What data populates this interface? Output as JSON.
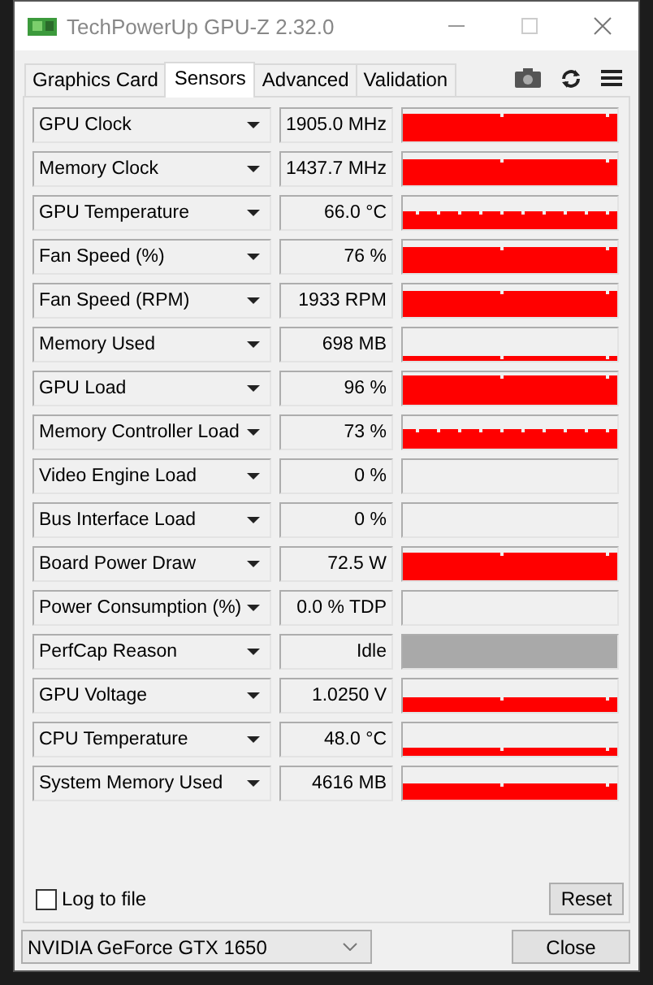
{
  "window": {
    "title": "TechPowerUp GPU-Z 2.32.0"
  },
  "tabs": [
    {
      "label": "Graphics Card",
      "selected": false
    },
    {
      "label": "Sensors",
      "selected": true
    },
    {
      "label": "Advanced",
      "selected": false
    },
    {
      "label": "Validation",
      "selected": false
    }
  ],
  "sensors": [
    {
      "name": "GPU Clock",
      "reading": "1905.0 MHz",
      "kind": "graph"
    },
    {
      "name": "Memory Clock",
      "reading": "1437.7 MHz",
      "kind": "graph"
    },
    {
      "name": "GPU Temperature",
      "reading": "66.0 °C",
      "kind": "graph"
    },
    {
      "name": "Fan Speed (%)",
      "reading": "76 %",
      "kind": "graph"
    },
    {
      "name": "Fan Speed (RPM)",
      "reading": "1933 RPM",
      "kind": "graph"
    },
    {
      "name": "Memory Used",
      "reading": "698 MB",
      "kind": "graph"
    },
    {
      "name": "GPU Load",
      "reading": "96 %",
      "kind": "graph"
    },
    {
      "name": "Memory Controller Load",
      "reading": "73 %",
      "kind": "graph"
    },
    {
      "name": "Video Engine Load",
      "reading": "0 %",
      "kind": "graph"
    },
    {
      "name": "Bus Interface Load",
      "reading": "0 %",
      "kind": "graph"
    },
    {
      "name": "Board Power Draw",
      "reading": "72.5 W",
      "kind": "graph"
    },
    {
      "name": "Power Consumption (%)",
      "reading": "0.0 % TDP",
      "kind": "graph"
    },
    {
      "name": "PerfCap Reason",
      "reading": "Idle",
      "kind": "status"
    },
    {
      "name": "GPU Voltage",
      "reading": "1.0250 V",
      "kind": "graph"
    },
    {
      "name": "CPU Temperature",
      "reading": "48.0 °C",
      "kind": "graph"
    },
    {
      "name": "System Memory Used",
      "reading": "4616 MB",
      "kind": "graph"
    }
  ],
  "log_to_file": {
    "label": "Log to file",
    "checked": false
  },
  "reset_button": "Reset",
  "gpu_select": "NVIDIA GeForce GTX 1650",
  "close_button": "Close"
}
